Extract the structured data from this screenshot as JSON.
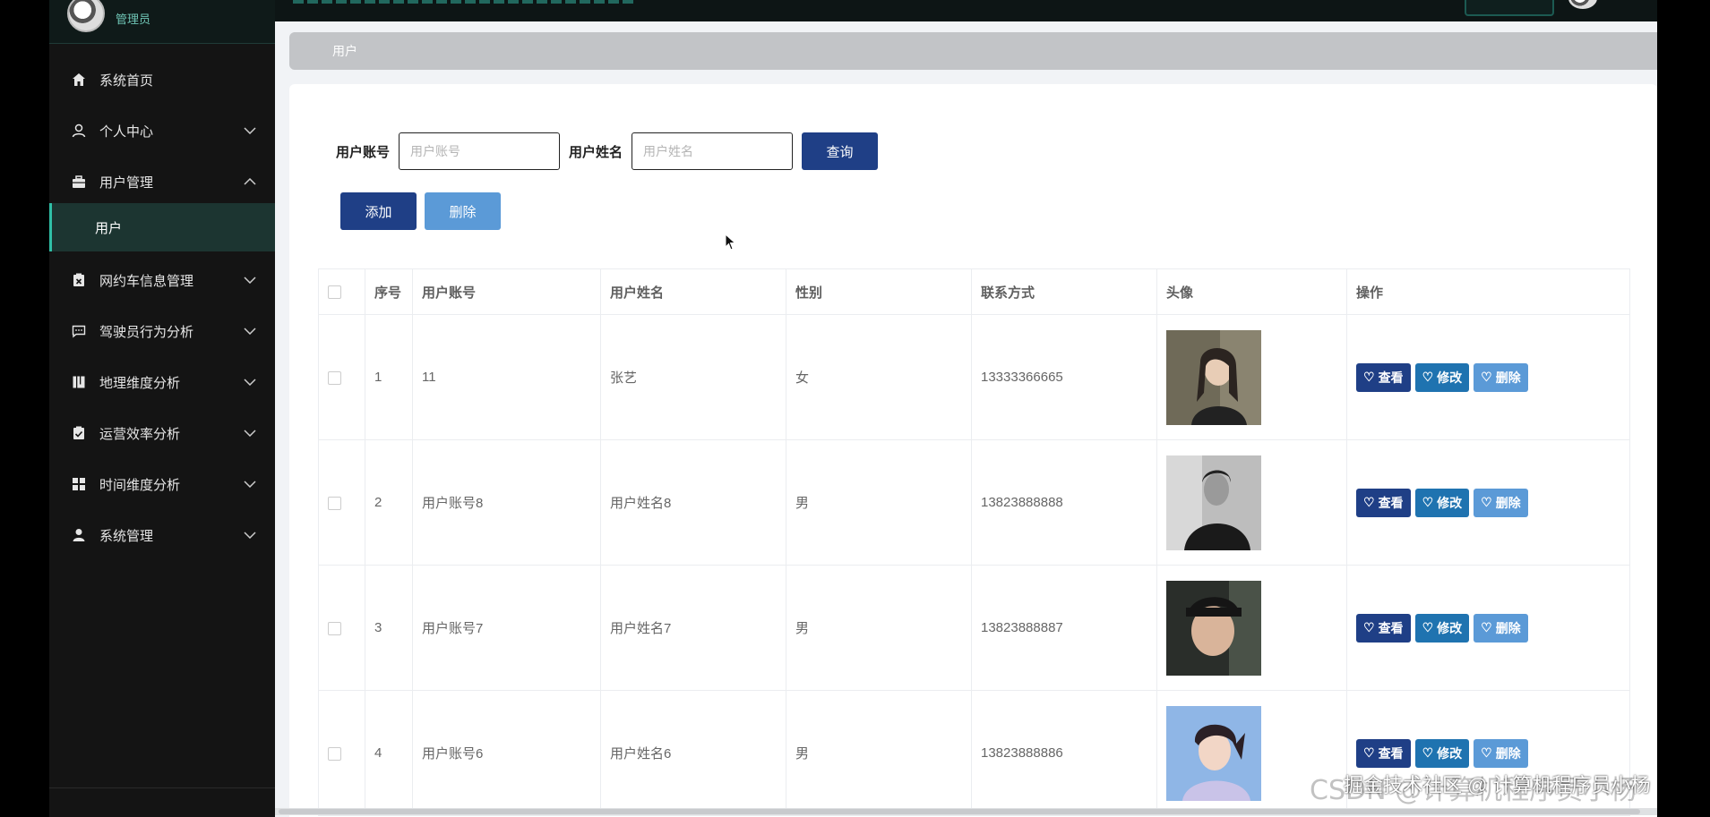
{
  "sidebar": {
    "role": "管理员",
    "items": [
      {
        "label": "系统首页",
        "icon": "home-icon",
        "chevron": ""
      },
      {
        "label": "个人中心",
        "icon": "user-icon",
        "chevron": "down"
      },
      {
        "label": "用户管理",
        "icon": "briefcase-icon",
        "chevron": "up"
      },
      {
        "label": "网约车信息管理",
        "icon": "clipboard-x-icon",
        "chevron": "down"
      },
      {
        "label": "驾驶员行为分析",
        "icon": "message-icon",
        "chevron": "down"
      },
      {
        "label": "地理维度分析",
        "icon": "book-icon",
        "chevron": "down"
      },
      {
        "label": "运营效率分析",
        "icon": "clipboard-check-icon",
        "chevron": "down"
      },
      {
        "label": "时间维度分析",
        "icon": "grid-icon",
        "chevron": "down"
      },
      {
        "label": "系统管理",
        "icon": "person-icon",
        "chevron": "down"
      }
    ],
    "sub_item": "用户"
  },
  "breadcrumb": "用户",
  "search": {
    "account_label": "用户账号",
    "account_placeholder": "用户账号",
    "name_label": "用户姓名",
    "name_placeholder": "用户姓名",
    "query_button": "查询"
  },
  "actions": {
    "add": "添加",
    "delete": "删除"
  },
  "table": {
    "headers": [
      "序号",
      "用户账号",
      "用户姓名",
      "性别",
      "联系方式",
      "头像",
      "操作"
    ],
    "rows": [
      {
        "index": "1",
        "account": "11",
        "name": "张艺",
        "gender": "女",
        "phone": "13333366665"
      },
      {
        "index": "2",
        "account": "用户账号8",
        "name": "用户姓名8",
        "gender": "男",
        "phone": "13823888888"
      },
      {
        "index": "3",
        "account": "用户账号7",
        "name": "用户姓名7",
        "gender": "男",
        "phone": "13823888887"
      },
      {
        "index": "4",
        "account": "用户账号6",
        "name": "用户姓名6",
        "gender": "男",
        "phone": "13823888886"
      }
    ],
    "op_view": "查看",
    "op_edit": "修改",
    "op_delete": "删除"
  },
  "watermark": "CSDN @计算机程序员小杨",
  "watermark_overlay": "掘金技术社区 @ 计算机程序员小杨",
  "colors": {
    "primary": "#1f3f86",
    "edit": "#1f73b0",
    "light": "#5b9ad7",
    "sidebar_bg": "#141414",
    "accent": "#2fbfa6"
  }
}
